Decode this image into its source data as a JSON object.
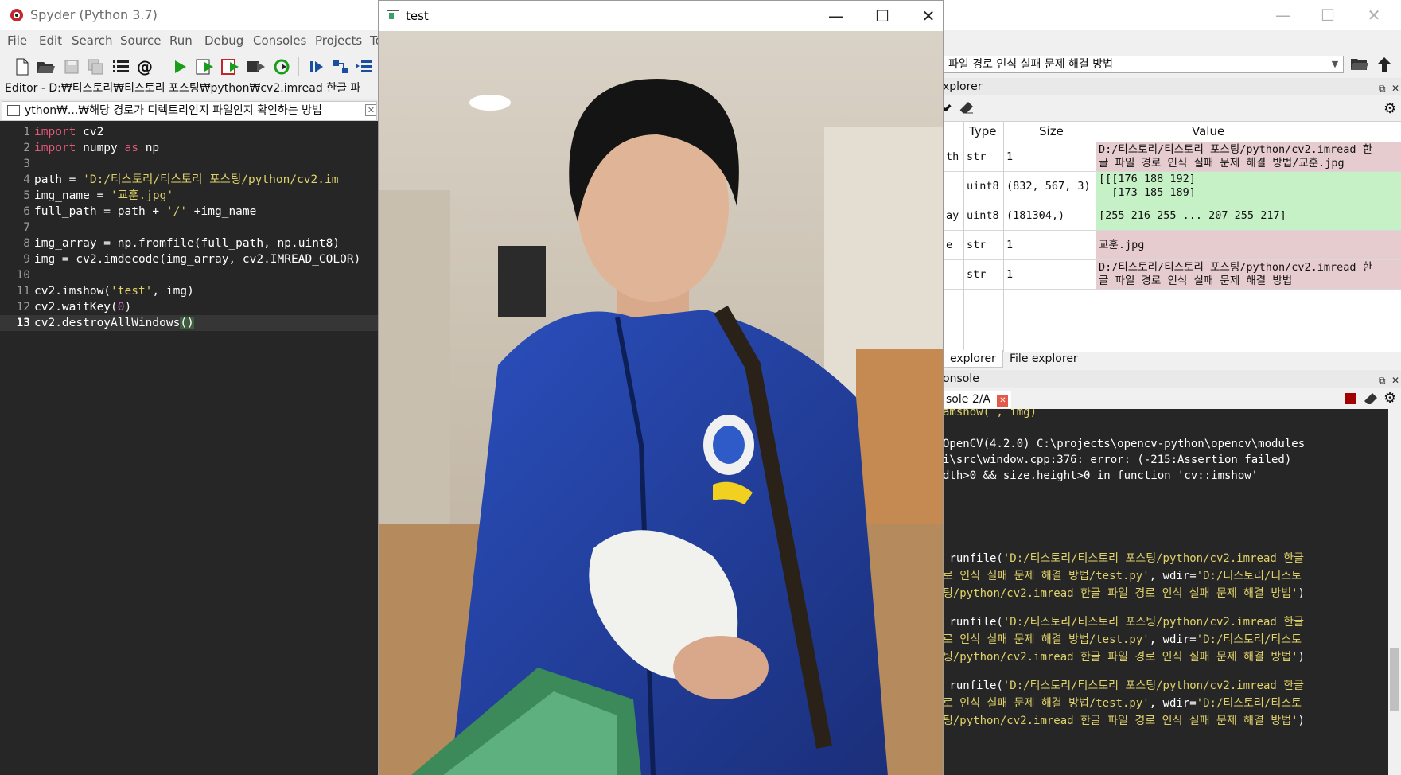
{
  "spyder": {
    "title": "Spyder (Python 3.7)",
    "menus": [
      "File",
      "Edit",
      "Search",
      "Source",
      "Run",
      "Debug",
      "Consoles",
      "Projects",
      "To"
    ],
    "editor_header": "Editor - D:₩티스토리₩티스토리 포스팅₩python₩cv2.imread 한글 파",
    "editor_tab": "ython₩...₩해당 경로가 디렉토리인지 파일인지 확인하는 방법",
    "code": [
      {
        "n": "1"
      },
      {
        "n": "2"
      },
      {
        "n": "3"
      },
      {
        "n": "4"
      },
      {
        "n": "5"
      },
      {
        "n": "6"
      },
      {
        "n": "7"
      },
      {
        "n": "8"
      },
      {
        "n": "9"
      },
      {
        "n": "10"
      },
      {
        "n": "11"
      },
      {
        "n": "12"
      },
      {
        "n": "13"
      }
    ],
    "code_text": {
      "l1_kw": "import",
      "l1_rest": " cv2",
      "l2_kw": "import",
      "l2_mid": " numpy ",
      "l2_kw2": "as",
      "l2_rest": " np",
      "l4_pre": "path = ",
      "l4_str": "'D:/티스토리/티스토리 포스팅/python/cv2.im",
      "l5_pre": "img_name = ",
      "l5_str": "'교훈.jpg'",
      "l6_pre": "full_path = path + ",
      "l6_str": "'/'",
      "l6_rest": " +img_name",
      "l8": "img_array = np.fromfile(full_path, np.uint8)",
      "l9": "img = cv2.imdecode(img_array, cv2.IMREAD_COLOR)",
      "l11_pre": "cv2.imshow(",
      "l11_str": "'test'",
      "l11_rest": ", img)",
      "l12_pre": "cv2.waitKey(",
      "l12_num": "0",
      "l12_rest": ")",
      "l13_pre": "cv2.destroyAllWindows",
      "l13_paren": "()"
    }
  },
  "right": {
    "working_dir": "파일 경로 인식 실패 문제 해결 방법",
    "variable_explorer_title": "xplorer",
    "columns": {
      "type": "Type",
      "size": "Size",
      "value": "Value"
    },
    "variables": [
      {
        "name": "th",
        "type": "str",
        "size": "1",
        "value": "D:/티스토리/티스토리 포스팅/python/cv2.imread 한\n글 파일 경로 인식 실패 문제 해결 방법/교훈.jpg",
        "color": "#e6cbcf"
      },
      {
        "name": "",
        "type": "uint8",
        "size": "(832, 567, 3)",
        "value": "[[[176 188 192]\n  [173 185 189]",
        "color": "#c6f0c6"
      },
      {
        "name": "ay",
        "type": "uint8",
        "size": "(181304,)",
        "value": "[255 216 255 ... 207 255 217]",
        "color": "#c6f0c6"
      },
      {
        "name": "e",
        "type": "str",
        "size": "1",
        "value": "교훈.jpg",
        "color": "#e6cbcf"
      },
      {
        "name": "",
        "type": "str",
        "size": "1",
        "value": "D:/티스토리/티스토리 포스팅/python/cv2.imread 한\n글 파일 경로 인식 실패 문제 해결 방법",
        "color": "#e6cbcf"
      }
    ],
    "bottom_tabs": [
      "explorer",
      "File explorer"
    ],
    "console_title": "onsole",
    "console_tab": "sole 2/A",
    "console_lines": [
      {
        "t": "OpenCV(4.2.0) C:\\projects\\opencv-python\\opencv\\modules",
        "y": ""
      },
      {
        "t": "i\\src\\window.cpp:376: error: (-215:Assertion failed)",
        "y": ""
      },
      {
        "t": "dth>0 && size.height>0 in function 'cv::imshow'",
        "y": ""
      },
      {
        "t": " runfile(",
        "y": "'D:/티스토리/티스토리 포스팅/python/cv2.imread 한글"
      },
      {
        "t": "",
        "y": "로 인식 실패 문제 해결 방법/test.py'",
        "t2": ", wdir=",
        "y2": "'D:/티스토리/티스토"
      },
      {
        "t": "",
        "y": "팅/python/cv2.imread 한글 파일 경로 인식 실패 문제 해결 방법'",
        "t2": ")"
      },
      {
        "t": " runfile(",
        "y": "'D:/티스토리/티스토리 포스팅/python/cv2.imread 한글"
      },
      {
        "t": "",
        "y": "로 인식 실패 문제 해결 방법/test.py'",
        "t2": ", wdir=",
        "y2": "'D:/티스토리/티스토"
      },
      {
        "t": "",
        "y": "팅/python/cv2.imread 한글 파일 경로 인식 실패 문제 해결 방법'",
        "t2": ")"
      },
      {
        "t": " runfile(",
        "y": "'D:/티스토리/티스토리 포스팅/python/cv2.imread 한글"
      },
      {
        "t": "",
        "y": "로 인식 실패 문제 해결 방법/test.py'",
        "t2": ", wdir=",
        "y2": "'D:/티스토리/티스토"
      },
      {
        "t": "",
        "y": "팅/python/cv2.imread 한글 파일 경로 인식 실패 문제 해결 방법'",
        "t2": ")"
      }
    ]
  },
  "test_window": {
    "title": "test"
  },
  "colors": {
    "editor_bg": "#262626",
    "string": "#e0d26a",
    "keyword": "#e6587a",
    "number": "#d06bd0"
  }
}
